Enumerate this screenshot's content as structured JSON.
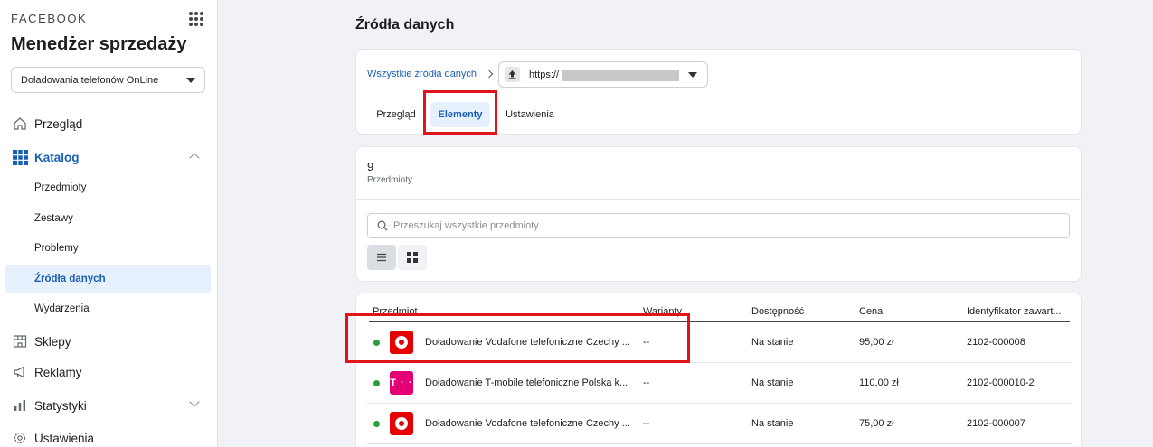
{
  "sidebar": {
    "brand": "FACEBOOK",
    "app_title": "Menedżer sprzedaży",
    "account": "Doładowania telefonów OnLine",
    "nav": {
      "overview": "Przegląd",
      "catalog": "Katalog",
      "catalog_sub": [
        "Przedmioty",
        "Zestawy",
        "Problemy",
        "Źródła danych",
        "Wydarzenia"
      ],
      "shops": "Sklepy",
      "ads": "Reklamy",
      "stats": "Statystyki",
      "settings": "Ustawienia"
    },
    "accent": "#1a5fb4"
  },
  "main": {
    "title": "Źródła danych",
    "breadcrumb_link": "Wszystkie źródła danych",
    "source_url": "https://",
    "tabs": [
      "Przegląd",
      "Elementy",
      "Ustawienia"
    ],
    "active_tab": "Elementy",
    "item_count": "9",
    "item_count_label": "Przedmioty",
    "search_placeholder": "Przeszukaj wszystkie przedmioty",
    "table": {
      "columns": [
        "Przedmiot",
        "Warianty",
        "Dostępność",
        "Cena",
        "Identyfikator zawart..."
      ],
      "rows": [
        {
          "brand": "vodafone",
          "name": "Doładowanie Vodafone telefoniczne Czechy ...",
          "variants": "--",
          "availability": "Na stanie",
          "price": "95,00 zł",
          "id": "2102-000008"
        },
        {
          "brand": "t-mobile",
          "name": "Doładowanie T-mobile telefoniczne Polska k...",
          "variants": "--",
          "availability": "Na stanie",
          "price": "110,00 zł",
          "id": "2102-000010-2"
        },
        {
          "brand": "vodafone",
          "name": "Doładowanie Vodafone telefoniczne Czechy ...",
          "variants": "--",
          "availability": "Na stanie",
          "price": "75,00 zł",
          "id": "2102-000007"
        }
      ]
    },
    "tmobile_logo_text": "T · ·",
    "highlight_color": "#e0121a"
  }
}
